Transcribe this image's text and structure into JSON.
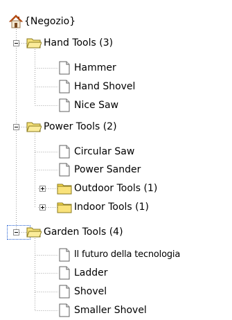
{
  "tree": {
    "root": {
      "label": "{Negozio}",
      "icon": "home-icon"
    },
    "groups": [
      {
        "label": "Hand Tools (3)",
        "expanded": true,
        "icon": "folder-open-icon",
        "items": [
          {
            "label": "Hammer",
            "type": "document"
          },
          {
            "label": "Hand Shovel",
            "type": "document"
          },
          {
            "label": "Nice Saw",
            "type": "document"
          }
        ]
      },
      {
        "label": "Power Tools (2)",
        "expanded": true,
        "icon": "folder-open-icon",
        "items": [
          {
            "label": "Circular Saw",
            "type": "document"
          },
          {
            "label": "Power Sander",
            "type": "document"
          },
          {
            "label": "Outdoor Tools (1)",
            "type": "folder",
            "expanded": false
          },
          {
            "label": "Indoor Tools (1)",
            "type": "folder",
            "expanded": false
          }
        ]
      },
      {
        "label": "Garden Tools (4)",
        "expanded": true,
        "focused": true,
        "icon": "folder-open-icon",
        "items": [
          {
            "label": "Il futuro della tecnologia",
            "type": "document"
          },
          {
            "label": "Ladder",
            "type": "document"
          },
          {
            "label": "Shovel",
            "type": "document"
          },
          {
            "label": "Smaller Shovel",
            "type": "document"
          }
        ]
      }
    ]
  },
  "colors": {
    "folder_fill": "#f6e27a",
    "folder_edge": "#8a7a1f",
    "home_roof": "#e06a1f",
    "focus_border": "#1e5bd0",
    "line": "#a0a0a0"
  }
}
